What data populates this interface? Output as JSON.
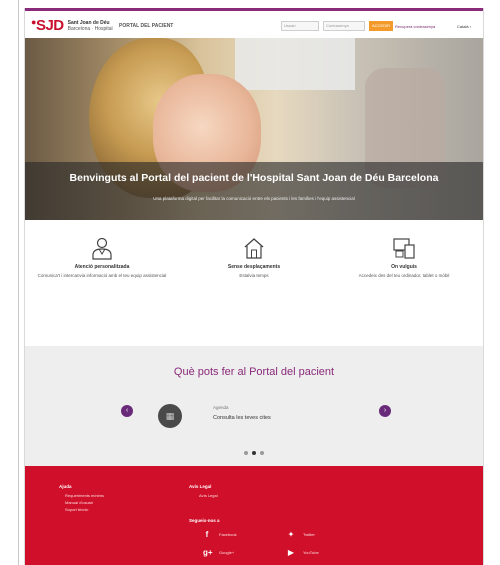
{
  "header": {
    "logo_mark": "SJD",
    "logo_name": "Sant Joan de Déu",
    "logo_sub": "Barcelona · Hospital",
    "portal_title": "PORTAL DEL PACIENT",
    "user_placeholder": "Usuari",
    "password_placeholder": "Contrasenya",
    "access_button": "ACCEDIR",
    "forgot_password": "Recupera contrasenya",
    "language": "Català"
  },
  "hero": {
    "title": "Benvinguts al Portal del pacient de l'Hospital Sant Joan de Déu Barcelona",
    "subtitle": "Una plataforma digital per facilitar la comunicació entre els pacients i les famílies i l'equip assistencial"
  },
  "features": [
    {
      "icon": "doctor-icon",
      "title": "Atenció personalitzada",
      "desc": "Comunica't i intercanvia informació amb el teu equip assistencial"
    },
    {
      "icon": "home-icon",
      "title": "Sense desplaçaments",
      "desc": "Estalvia temps"
    },
    {
      "icon": "devices-icon",
      "title": "On vulguis",
      "desc": "Accedeix des del teu ordinador, tablet o mòbil"
    }
  ],
  "carousel": {
    "heading": "Què pots fer al Portal del pacient",
    "prev": "‹",
    "next": "›",
    "card_label": "Agenda",
    "card_title": "Consulta les teves cites",
    "card_icon": "calendar-icon",
    "pages": 3,
    "active_page": 2
  },
  "footer": {
    "help_heading": "Ajuda",
    "help_links": [
      "Requeriments mínims",
      "Manual d'usuari",
      "Suport tècnic"
    ],
    "legal_heading": "Avís Legal",
    "legal_link": "Avís Legal",
    "follow_heading": "Segueix-nos a",
    "social": [
      {
        "icon": "facebook-icon",
        "glyph": "f",
        "label": "Facebook"
      },
      {
        "icon": "twitter-icon",
        "glyph": "🐦",
        "label": "Twitter"
      },
      {
        "icon": "google-plus-icon",
        "glyph": "g+",
        "label": "Google+"
      },
      {
        "icon": "youtube-icon",
        "glyph": "▶",
        "label": "YouTube"
      }
    ]
  },
  "colors": {
    "brand_red": "#d0102a",
    "brand_purple": "#8a2a7a",
    "accent_orange": "#f39a2b"
  }
}
